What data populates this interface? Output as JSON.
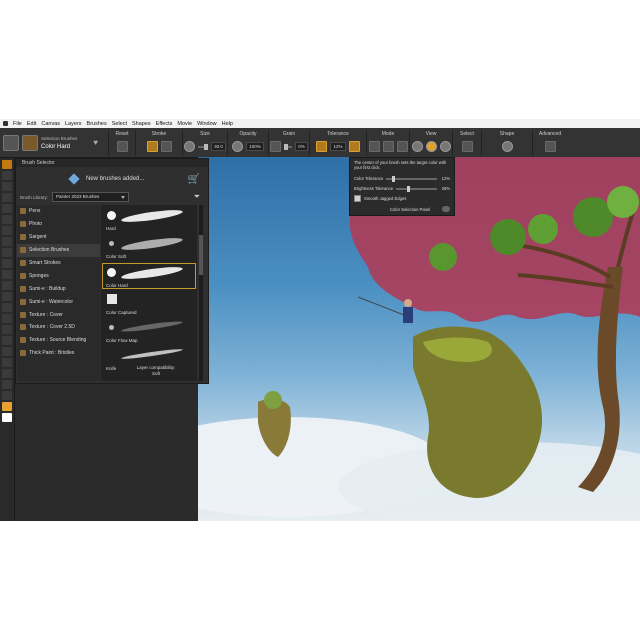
{
  "menu": [
    "File",
    "Edit",
    "Canvas",
    "Layers",
    "Brushes",
    "Select",
    "Shapes",
    "Effects",
    "Movie",
    "Window",
    "Help"
  ],
  "propbar": {
    "brush_category": "Selection Brushes",
    "brush_variant": "Color Hard",
    "groups": {
      "reset": "Reset",
      "stroke": "Stroke",
      "size": "Size",
      "opacity": "Opacity",
      "grain": "Grain",
      "tolerance": "Tolerance",
      "mode": "Mode",
      "view": "View",
      "select": "Select",
      "shape": "Shape",
      "advanced": "Advanced"
    },
    "size_value": "30.0",
    "opacity_value": "100%",
    "grain_value": "0%",
    "tolerance_value": "12%"
  },
  "brush_selector": {
    "title": "Brush Selector",
    "new_brushes": "New brushes added...",
    "library_label": "Brush Library:",
    "library_value": "Painter 2023 Brushes",
    "categories": [
      {
        "label": "Pens"
      },
      {
        "label": "Photo"
      },
      {
        "label": "Sargent"
      },
      {
        "label": "Selection Brushes"
      },
      {
        "label": "Smart Strokes"
      },
      {
        "label": "Sponges"
      },
      {
        "label": "Sumi-e : Buildup"
      },
      {
        "label": "Sumi-e : Watercolor"
      },
      {
        "label": "Texture : Cover"
      },
      {
        "label": "Texture : Cover 2.5D"
      },
      {
        "label": "Texture : Source Blending"
      },
      {
        "label": "Thick Paint : Bristles"
      }
    ],
    "variants": [
      {
        "label": "Hard"
      },
      {
        "label": "Color Soft"
      },
      {
        "label": "Color Hard"
      },
      {
        "label": "Color Captured"
      },
      {
        "label": "Color Flow Map"
      },
      {
        "label": "Knife"
      }
    ],
    "compat_label": "Layer compatibility:",
    "compat_value": "Soft"
  },
  "color_selection": {
    "description": "The center of your brush sets the target color with your first click.",
    "color_tolerance_label": "Color Tolerance",
    "color_tolerance_value": "12%",
    "brightness_tolerance_label": "Brightness Tolerance",
    "brightness_tolerance_value": "26%",
    "tolerance": 0.12,
    "brightness": 0.26,
    "smooth_label": "Smooth Jagged Edges",
    "panel_label": "Color Selection Panel"
  },
  "colors": {
    "accent": "#c07a10",
    "selection_overlay": "#b03a55",
    "sky_top": "#2f6fa8",
    "sky_bottom": "#e8eef2"
  }
}
